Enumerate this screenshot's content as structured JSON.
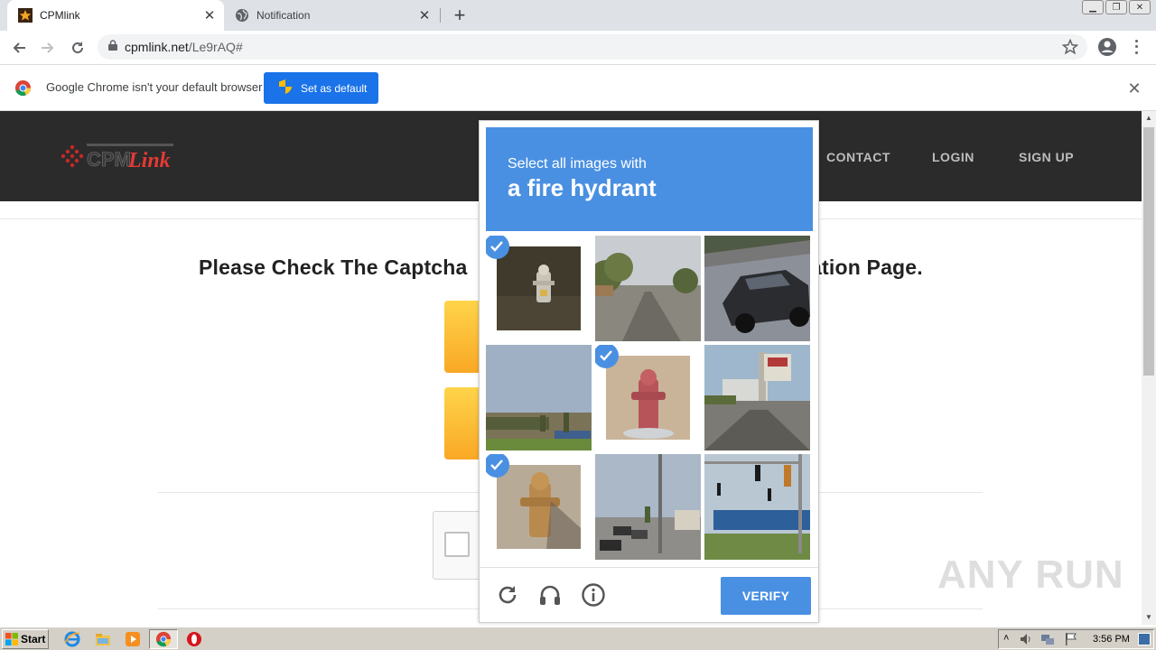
{
  "browser": {
    "tabs": [
      {
        "title": "CPMlink",
        "active": true
      },
      {
        "title": "Notification",
        "active": false
      }
    ],
    "url_host": "cpmlink.net",
    "url_path": "/Le9rAQ#"
  },
  "infobar": {
    "message": "Google Chrome isn't your default browser",
    "button_label": "Set as default"
  },
  "site": {
    "nav": [
      "CONTACT",
      "LOGIN",
      "SIGN UP"
    ],
    "headline_start": "Please Check The Captcha",
    "headline_end": "ation Page."
  },
  "captcha": {
    "instruction": "Select all images with",
    "target": "a fire hydrant",
    "tiles": [
      {
        "name": "hydrant-dark",
        "selected": true
      },
      {
        "name": "street-road",
        "selected": false
      },
      {
        "name": "car",
        "selected": false
      },
      {
        "name": "field",
        "selected": false
      },
      {
        "name": "hydrant-red",
        "selected": true
      },
      {
        "name": "building",
        "selected": false
      },
      {
        "name": "hydrant-yellow",
        "selected": true
      },
      {
        "name": "street-cars",
        "selected": false
      },
      {
        "name": "traffic-lights",
        "selected": false
      }
    ],
    "verify_label": "VERIFY",
    "accent": "#4a90e2"
  },
  "watermark": "ANY RUN",
  "taskbar": {
    "start_label": "Start",
    "clock": "3:56 PM"
  }
}
